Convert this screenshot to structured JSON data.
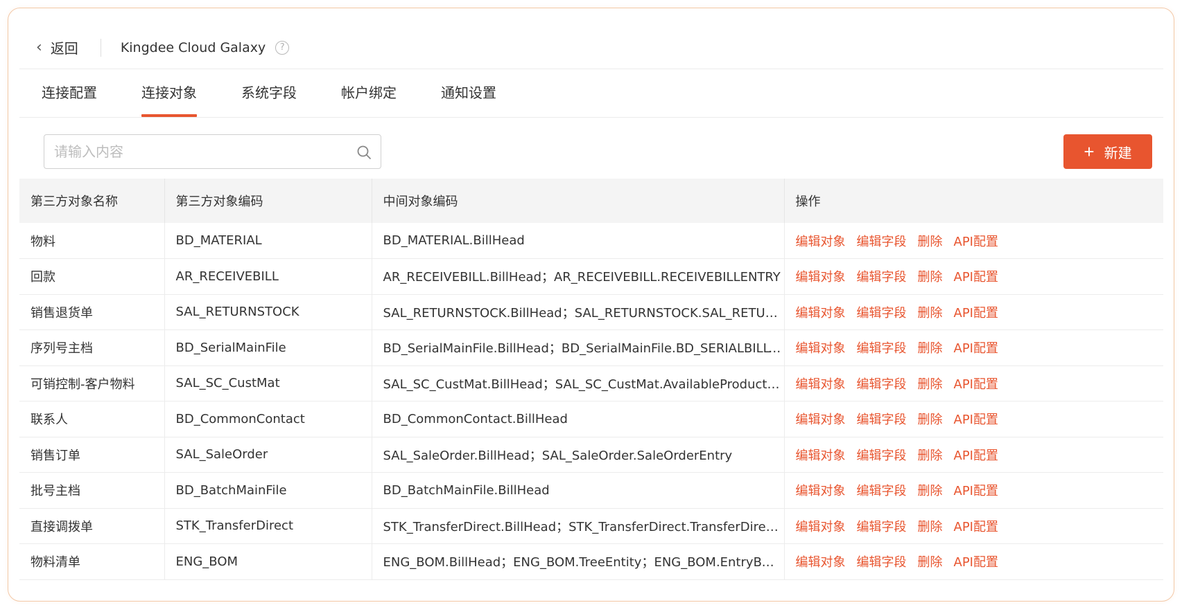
{
  "header": {
    "back_label": "返回",
    "app_title": "Kingdee Cloud Galaxy",
    "help_glyph": "?"
  },
  "tabs": [
    {
      "label": "连接配置",
      "active": false
    },
    {
      "label": "连接对象",
      "active": true
    },
    {
      "label": "系统字段",
      "active": false
    },
    {
      "label": "帐户绑定",
      "active": false
    },
    {
      "label": "通知设置",
      "active": false
    }
  ],
  "search": {
    "placeholder": "请输入内容",
    "value": ""
  },
  "new_button": {
    "label": "新建"
  },
  "table": {
    "columns": [
      "第三方对象名称",
      "第三方对象编码",
      "中间对象编码",
      "操作"
    ],
    "actions": [
      "编辑对象",
      "编辑字段",
      "删除",
      "API配置"
    ],
    "rows": [
      {
        "name": "物料",
        "code": "BD_MATERIAL",
        "mid": "BD_MATERIAL.BillHead"
      },
      {
        "name": "回款",
        "code": "AR_RECEIVEBILL",
        "mid": "AR_RECEIVEBILL.BillHead；AR_RECEIVEBILL.RECEIVEBILLENTRY"
      },
      {
        "name": "销售退货单",
        "code": "SAL_RETURNSTOCK",
        "mid": "SAL_RETURNSTOCK.BillHead；SAL_RETURNSTOCK.SAL_RETURNSTOCK..."
      },
      {
        "name": "序列号主档",
        "code": "BD_SerialMainFile",
        "mid": "BD_SerialMainFile.BillHead；BD_SerialMainFile.BD_SERIALBILLTRACE；..."
      },
      {
        "name": "可销控制-客户物料",
        "code": "SAL_SC_CustMat",
        "mid": "SAL_SC_CustMat.BillHead；SAL_SC_CustMat.AvailableProductObj；SAL..."
      },
      {
        "name": "联系人",
        "code": "BD_CommonContact",
        "mid": "BD_CommonContact.BillHead"
      },
      {
        "name": "销售订单",
        "code": "SAL_SaleOrder",
        "mid": "SAL_SaleOrder.BillHead；SAL_SaleOrder.SaleOrderEntry"
      },
      {
        "name": "批号主档",
        "code": "BD_BatchMainFile",
        "mid": "BD_BatchMainFile.BillHead"
      },
      {
        "name": "直接调拨单",
        "code": "STK_TransferDirect",
        "mid": "STK_TransferDirect.BillHead；STK_TransferDirect.TransferDirectEntry"
      },
      {
        "name": "物料清单",
        "code": "ENG_BOM",
        "mid": "ENG_BOM.BillHead；ENG_BOM.TreeEntity；ENG_BOM.EntryBOMCOBY..."
      }
    ]
  },
  "colors": {
    "accent": "#e8552f",
    "frame_border": "#f3c9a8",
    "header_bg": "#f4f4f4"
  }
}
